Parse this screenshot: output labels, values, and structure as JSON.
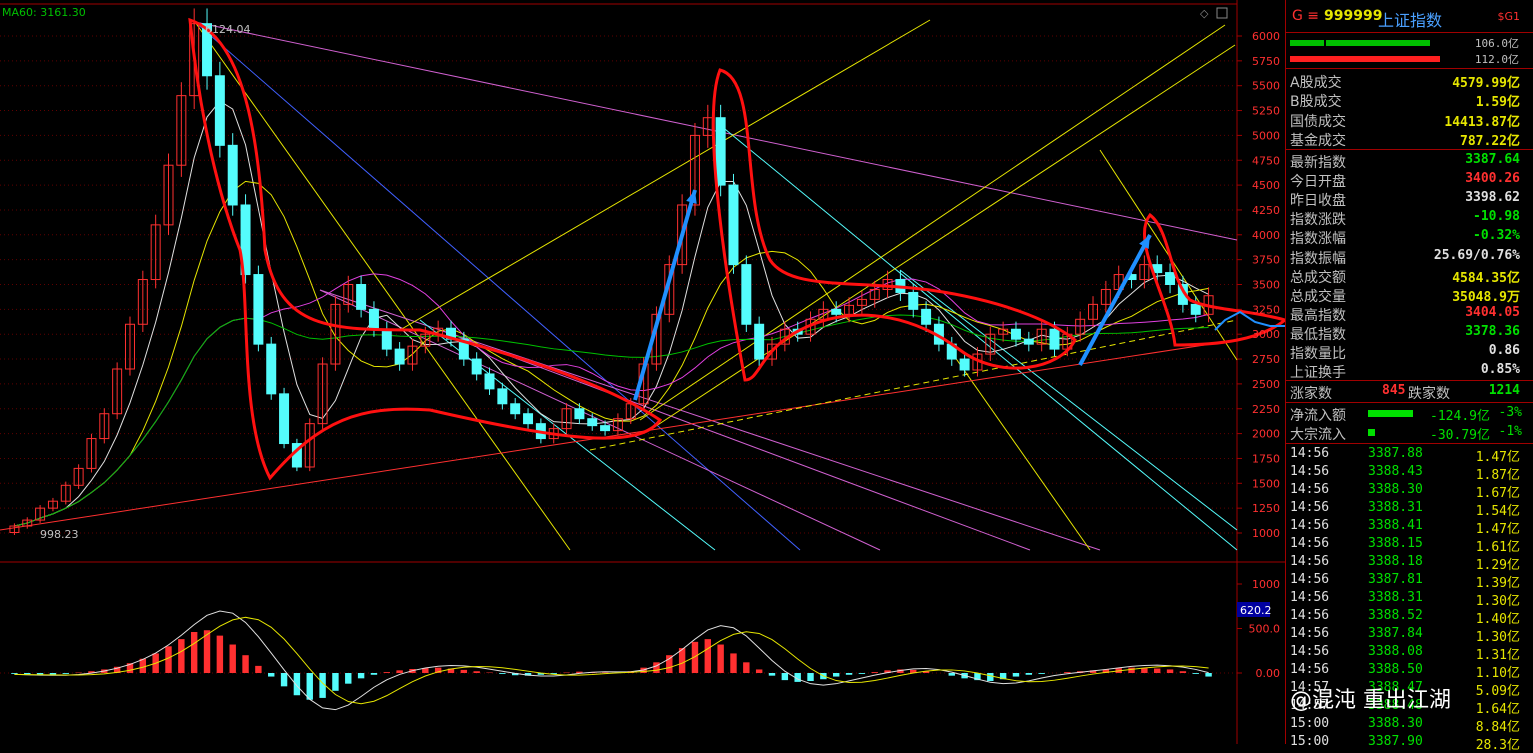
{
  "ma_label": "MA60: 3161.30",
  "high_label": "6124.04",
  "low_label": "998.23",
  "y_ticks": [
    "6000",
    "5750",
    "5500",
    "5250",
    "5000",
    "4750",
    "4500",
    "4250",
    "4000",
    "3750",
    "3500",
    "3250",
    "3000",
    "2750",
    "2500",
    "2250",
    "2000",
    "1750",
    "1500",
    "1250",
    "1000"
  ],
  "macd_ticks": [
    "1000",
    "500.0",
    "0.00"
  ],
  "macd_current": "620.2",
  "chart_data": {
    "type": "candlestick",
    "ylim": [
      800,
      6200
    ],
    "candles": [
      [
        1005,
        1070
      ],
      [
        1070,
        1130
      ],
      [
        1130,
        1250
      ],
      [
        1250,
        1320
      ],
      [
        1320,
        1480
      ],
      [
        1480,
        1650
      ],
      [
        1650,
        1950
      ],
      [
        1950,
        2200
      ],
      [
        2200,
        2650
      ],
      [
        2650,
        3100
      ],
      [
        3100,
        3550
      ],
      [
        3550,
        4100
      ],
      [
        4100,
        4700
      ],
      [
        4700,
        5400
      ],
      [
        5400,
        6124
      ],
      [
        6124,
        5600
      ],
      [
        5600,
        4900
      ],
      [
        4900,
        4300
      ],
      [
        4300,
        3600
      ],
      [
        3600,
        2900
      ],
      [
        2900,
        2400
      ],
      [
        2400,
        1900
      ],
      [
        1900,
        1664
      ],
      [
        1664,
        2100
      ],
      [
        2100,
        2700
      ],
      [
        2700,
        3300
      ],
      [
        3300,
        3500
      ],
      [
        3500,
        3250
      ],
      [
        3250,
        3050
      ],
      [
        3050,
        2850
      ],
      [
        2850,
        2700
      ],
      [
        2700,
        2880
      ],
      [
        2880,
        3000
      ],
      [
        3000,
        3060
      ],
      [
        3060,
        2950
      ],
      [
        2950,
        2750
      ],
      [
        2750,
        2600
      ],
      [
        2600,
        2450
      ],
      [
        2450,
        2300
      ],
      [
        2300,
        2200
      ],
      [
        2200,
        2100
      ],
      [
        2100,
        1950
      ],
      [
        1950,
        2050
      ],
      [
        2050,
        2250
      ],
      [
        2250,
        2150
      ],
      [
        2150,
        2080
      ],
      [
        2080,
        2030
      ],
      [
        2030,
        2150
      ],
      [
        2150,
        2300
      ],
      [
        2300,
        2700
      ],
      [
        2700,
        3200
      ],
      [
        3200,
        3700
      ],
      [
        3700,
        4300
      ],
      [
        4300,
        5000
      ],
      [
        5000,
        5178
      ],
      [
        5178,
        4500
      ],
      [
        4500,
        3700
      ],
      [
        3700,
        3100
      ],
      [
        3100,
        2750
      ],
      [
        2750,
        2900
      ],
      [
        2900,
        3050
      ],
      [
        3050,
        3000
      ],
      [
        3000,
        3150
      ],
      [
        3150,
        3250
      ],
      [
        3250,
        3200
      ],
      [
        3200,
        3290
      ],
      [
        3290,
        3350
      ],
      [
        3350,
        3450
      ],
      [
        3450,
        3550
      ],
      [
        3550,
        3420
      ],
      [
        3420,
        3250
      ],
      [
        3250,
        3100
      ],
      [
        3100,
        2900
      ],
      [
        2900,
        2750
      ],
      [
        2750,
        2640
      ],
      [
        2640,
        2800
      ],
      [
        2800,
        3000
      ],
      [
        3000,
        3050
      ],
      [
        3050,
        2950
      ],
      [
        2950,
        2900
      ],
      [
        2900,
        3050
      ],
      [
        3050,
        2850
      ],
      [
        2850,
        3000
      ],
      [
        3000,
        3150
      ],
      [
        3150,
        3300
      ],
      [
        3300,
        3450
      ],
      [
        3450,
        3600
      ],
      [
        3600,
        3550
      ],
      [
        3550,
        3700
      ],
      [
        3700,
        3620
      ],
      [
        3620,
        3500
      ],
      [
        3500,
        3300
      ],
      [
        3300,
        3200
      ],
      [
        3200,
        3387
      ]
    ],
    "macd": [
      -10,
      -15,
      -20,
      -18,
      -10,
      5,
      20,
      40,
      70,
      110,
      160,
      220,
      300,
      380,
      460,
      480,
      420,
      320,
      200,
      80,
      -40,
      -150,
      -250,
      -300,
      -280,
      -200,
      -120,
      -60,
      -20,
      10,
      30,
      45,
      55,
      60,
      50,
      35,
      20,
      5,
      -10,
      -25,
      -30,
      -20,
      -10,
      5,
      15,
      10,
      5,
      0,
      20,
      60,
      120,
      200,
      280,
      350,
      380,
      320,
      220,
      120,
      40,
      -30,
      -80,
      -100,
      -90,
      -70,
      -40,
      -20,
      -10,
      10,
      30,
      40,
      35,
      20,
      0,
      -30,
      -60,
      -80,
      -90,
      -70,
      -40,
      -20,
      -10,
      0,
      10,
      20,
      30,
      40,
      55,
      60,
      55,
      50,
      40,
      20,
      -10,
      -40
    ]
  },
  "panel": {
    "code_prefix": "G ≡",
    "code": "999999",
    "name": "上证指数",
    "tag": "$G1",
    "bar1_value": "106.0亿",
    "bar2_value": "112.0亿",
    "section_a": [
      {
        "label": "A股成交",
        "value": "4579.99亿",
        "color": "#e6e600"
      },
      {
        "label": "B股成交",
        "value": "1.59亿",
        "color": "#e6e600"
      },
      {
        "label": "国债成交",
        "value": "14413.87亿",
        "color": "#e6e600"
      },
      {
        "label": "基金成交",
        "value": "787.22亿",
        "color": "#e6e600"
      }
    ],
    "section_b": [
      {
        "label": "最新指数",
        "value": "3387.64",
        "color": "#00e000"
      },
      {
        "label": "今日开盘",
        "value": "3400.26",
        "color": "#ff3030"
      },
      {
        "label": "昨日收盘",
        "value": "3398.62",
        "color": "#e0e0e0"
      },
      {
        "label": "指数涨跌",
        "value": "-10.98",
        "color": "#00e000"
      },
      {
        "label": "指数涨幅",
        "value": "-0.32%",
        "color": "#00e000"
      },
      {
        "label": "指数振幅",
        "value": "25.69/0.76%",
        "color": "#e0e0e0"
      },
      {
        "label": "总成交额",
        "value": "4584.35亿",
        "color": "#e6e600"
      },
      {
        "label": "总成交量",
        "value": "35048.9万",
        "color": "#e6e600"
      },
      {
        "label": "最高指数",
        "value": "3404.05",
        "color": "#ff3030"
      },
      {
        "label": "最低指数",
        "value": "3378.36",
        "color": "#00e000"
      },
      {
        "label": "指数量比",
        "value": "0.86",
        "color": "#e0e0e0"
      },
      {
        "label": "上证换手",
        "value": "0.85%",
        "color": "#e0e0e0"
      }
    ],
    "up_label": "涨家数",
    "up_value": "845",
    "down_label": "跌家数",
    "down_value": "1214",
    "flows": [
      {
        "label": "净流入额",
        "value": "-124.9亿",
        "pct": "-3%",
        "bar": 50
      },
      {
        "label": "大宗流入",
        "value": "-30.79亿",
        "pct": "-1%",
        "bar": 8
      }
    ],
    "ticks": [
      {
        "time": "14:56",
        "price": "3387.88",
        "vol": "1.47亿"
      },
      {
        "time": "14:56",
        "price": "3388.43",
        "vol": "1.87亿"
      },
      {
        "time": "14:56",
        "price": "3388.30",
        "vol": "1.67亿"
      },
      {
        "time": "14:56",
        "price": "3388.31",
        "vol": "1.54亿"
      },
      {
        "time": "14:56",
        "price": "3388.41",
        "vol": "1.47亿"
      },
      {
        "time": "14:56",
        "price": "3388.15",
        "vol": "1.61亿"
      },
      {
        "time": "14:56",
        "price": "3388.18",
        "vol": "1.29亿"
      },
      {
        "time": "14:56",
        "price": "3387.81",
        "vol": "1.39亿"
      },
      {
        "time": "14:56",
        "price": "3388.31",
        "vol": "1.30亿"
      },
      {
        "time": "14:56",
        "price": "3388.52",
        "vol": "1.40亿"
      },
      {
        "time": "14:56",
        "price": "3387.84",
        "vol": "1.30亿"
      },
      {
        "time": "14:56",
        "price": "3388.08",
        "vol": "1.31亿"
      },
      {
        "time": "14:56",
        "price": "3388.50",
        "vol": "1.10亿"
      },
      {
        "time": "14:57",
        "price": "3388.47",
        "vol": "5.09亿"
      },
      {
        "time": "14:57",
        "price": "3388.48",
        "vol": "1.64亿"
      },
      {
        "time": "15:00",
        "price": "3388.30",
        "vol": "8.84亿"
      },
      {
        "time": "15:00",
        "price": "3387.90",
        "vol": "28.3亿"
      }
    ]
  },
  "watermark": "@混沌 重出江湖"
}
